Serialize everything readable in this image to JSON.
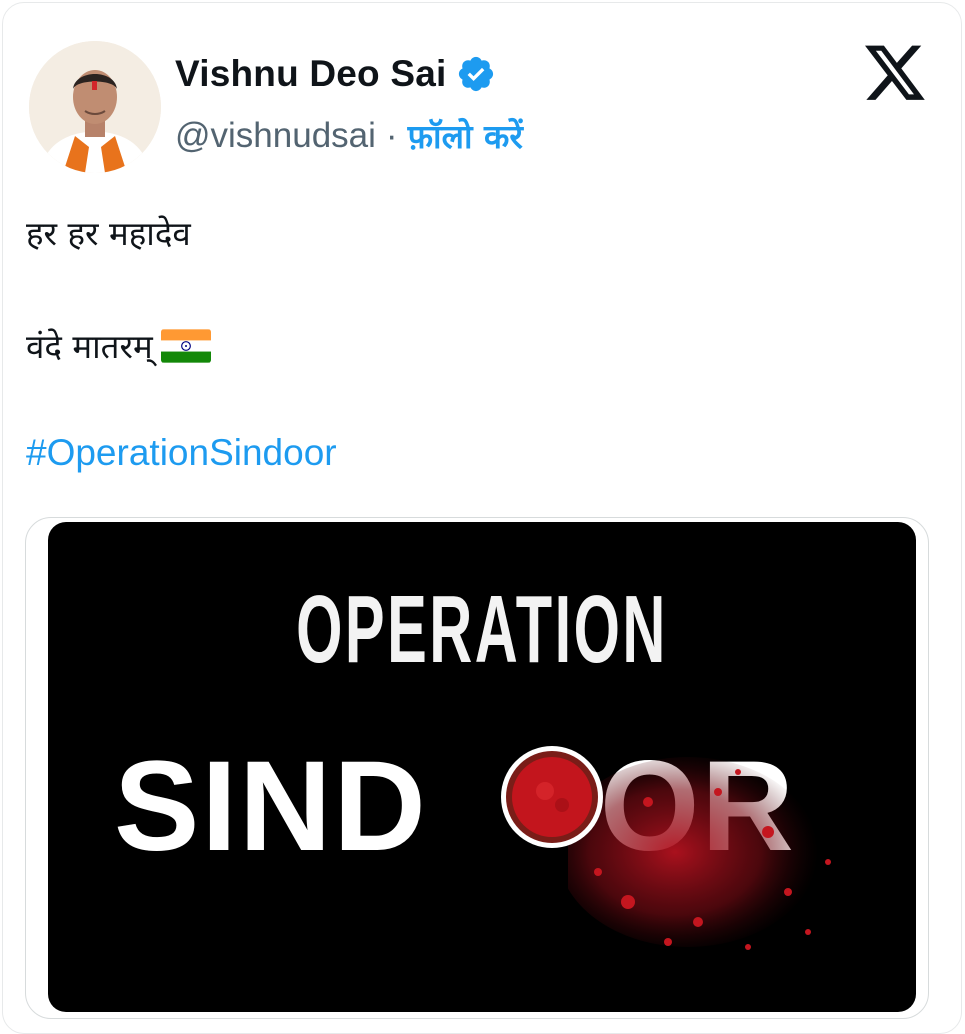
{
  "author": {
    "name": "Vishnu Deo Sai",
    "handle": "@vishnudsai",
    "separator": "·",
    "follow_label": "फ़ॉलो करें",
    "verified_color": "#1d9bf0"
  },
  "tweet": {
    "lines": [
      "हर हर महादेव",
      "वंदे मातरम्"
    ],
    "flag_emoji": "india-flag",
    "hashtag": "#OperationSindoor"
  },
  "media": {
    "line1": "OPERATION",
    "line2_left": "SIND",
    "line2_right": "OR",
    "accent_color": "#c8102e"
  },
  "icons": {
    "platform": "x-logo-icon",
    "verified": "verified-badge-icon"
  }
}
